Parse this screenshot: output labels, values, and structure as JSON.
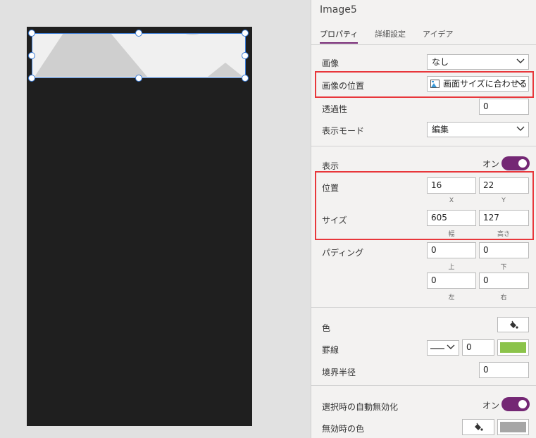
{
  "control_name": "Image5",
  "tabs": [
    {
      "label": "プロパティ",
      "active": true
    },
    {
      "label": "詳細設定",
      "active": false
    },
    {
      "label": "アイデア",
      "active": false
    }
  ],
  "properties": {
    "image": {
      "label": "画像",
      "value": "なし"
    },
    "image_position": {
      "label": "画像の位置",
      "value": "画面サイズに合わせる",
      "icon": "image-fit-icon"
    },
    "transparency": {
      "label": "透過性",
      "value": "0"
    },
    "display_mode": {
      "label": "表示モード",
      "value": "編集"
    },
    "visible": {
      "label": "表示",
      "toggle_text": "オン",
      "on": true
    },
    "position": {
      "label": "位置",
      "x": "16",
      "y": "22",
      "x_caption": "X",
      "y_caption": "Y"
    },
    "size": {
      "label": "サイズ",
      "width": "605",
      "height": "127",
      "width_caption": "幅",
      "height_caption": "高さ"
    },
    "padding": {
      "label": "パディング",
      "top": "0",
      "bottom": "0",
      "left": "0",
      "right": "0",
      "top_caption": "上",
      "bottom_caption": "下",
      "left_caption": "左",
      "right_caption": "右"
    },
    "color": {
      "label": "色",
      "icon": "paint-bucket-icon"
    },
    "border": {
      "label": "罫線",
      "width": "0",
      "style_icon": "line-style-icon",
      "color": "#8bc34a"
    },
    "border_radius": {
      "label": "境界半径",
      "value": "0"
    },
    "auto_disable": {
      "label": "選択時の自動無効化",
      "toggle_text": "オン",
      "on": true
    },
    "disabled_color": {
      "label": "無効時の色",
      "icon": "paint-bucket-icon",
      "color": "#a6a6a6"
    }
  },
  "colors": {
    "accent": "#742774",
    "highlight": "#e8373b",
    "canvas_screen": "#1f1f1f",
    "selection": "#3a7bd5"
  }
}
